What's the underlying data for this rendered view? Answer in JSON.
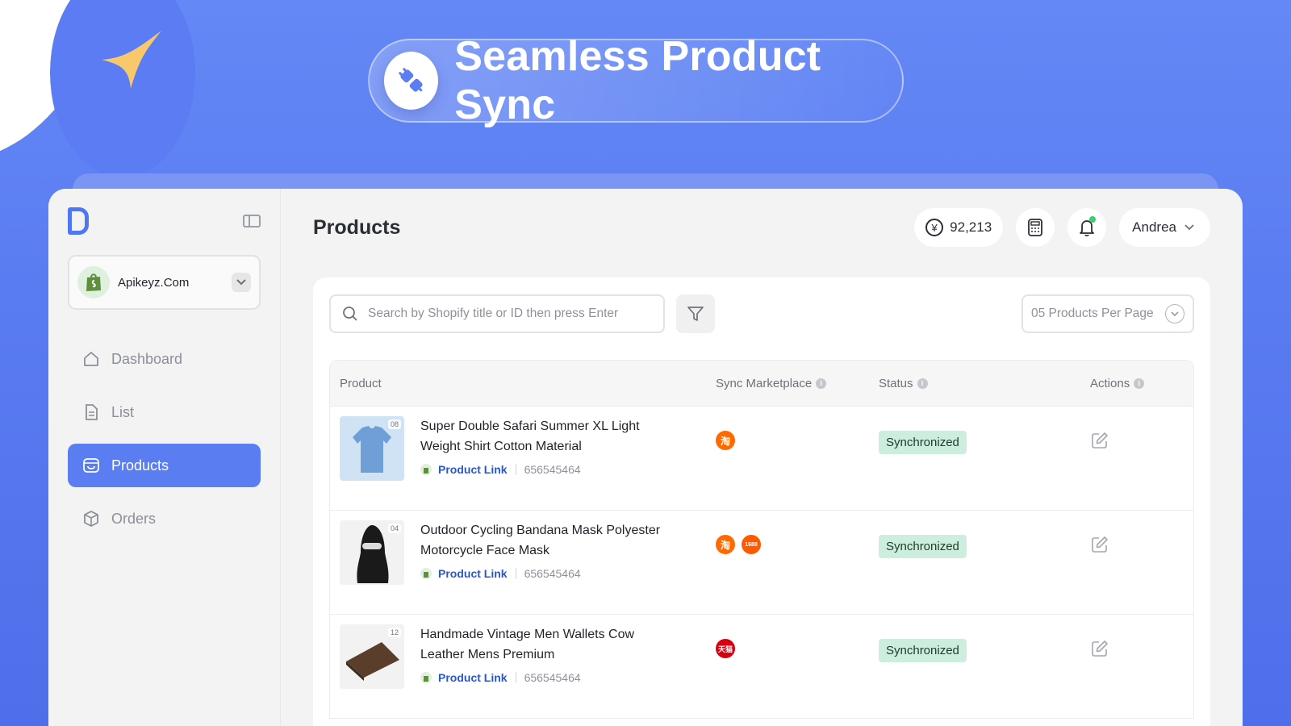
{
  "hero": {
    "title": "Seamless Product Sync",
    "icon": "plug-icon"
  },
  "sidebar": {
    "store": {
      "name": "Apikeyz.Com",
      "icon": "shopify-bag-icon"
    },
    "items": [
      {
        "label": "Dashboard",
        "icon": "home-icon",
        "active": false
      },
      {
        "label": "List",
        "icon": "document-icon",
        "active": false
      },
      {
        "label": "Products",
        "icon": "store-icon",
        "active": true
      },
      {
        "label": "Orders",
        "icon": "box-icon",
        "active": false
      }
    ]
  },
  "header": {
    "title": "Products",
    "balance": "92,213",
    "balance_currency_symbol": "¥",
    "user": "Andrea"
  },
  "toolbar": {
    "search_placeholder": "Search by Shopify title or ID then press Enter",
    "per_page": "05 Products Per Page"
  },
  "table": {
    "columns": [
      "Product",
      "Sync Marketplace",
      "Status",
      "Actions"
    ],
    "info_glyph": "i",
    "rows": [
      {
        "title": "Super Double Safari Summer XL Light Weight Shirt Cotton Material",
        "image_count": "08",
        "link_label": "Product Link",
        "product_id": "656545464",
        "marketplaces": [
          "taobao"
        ],
        "status": "Synchronized"
      },
      {
        "title": "Outdoor Cycling Bandana Mask Polyester Motorcycle Face Mask",
        "image_count": "04",
        "link_label": "Product Link",
        "product_id": "656545464",
        "marketplaces": [
          "taobao",
          "1688"
        ],
        "status": "Synchronized"
      },
      {
        "title": "Handmade Vintage Men Wallets Cow Leather Mens Premium",
        "image_count": "12",
        "link_label": "Product Link",
        "product_id": "656545464",
        "marketplaces": [
          "tmall"
        ],
        "status": "Synchronized"
      }
    ]
  },
  "marketplace_glyphs": {
    "taobao": "淘",
    "1688": "1688",
    "tmall": "天猫"
  },
  "colors": {
    "accent": "#5a7ef2",
    "status_bg": "#cdeede",
    "link": "#2a58c9"
  }
}
